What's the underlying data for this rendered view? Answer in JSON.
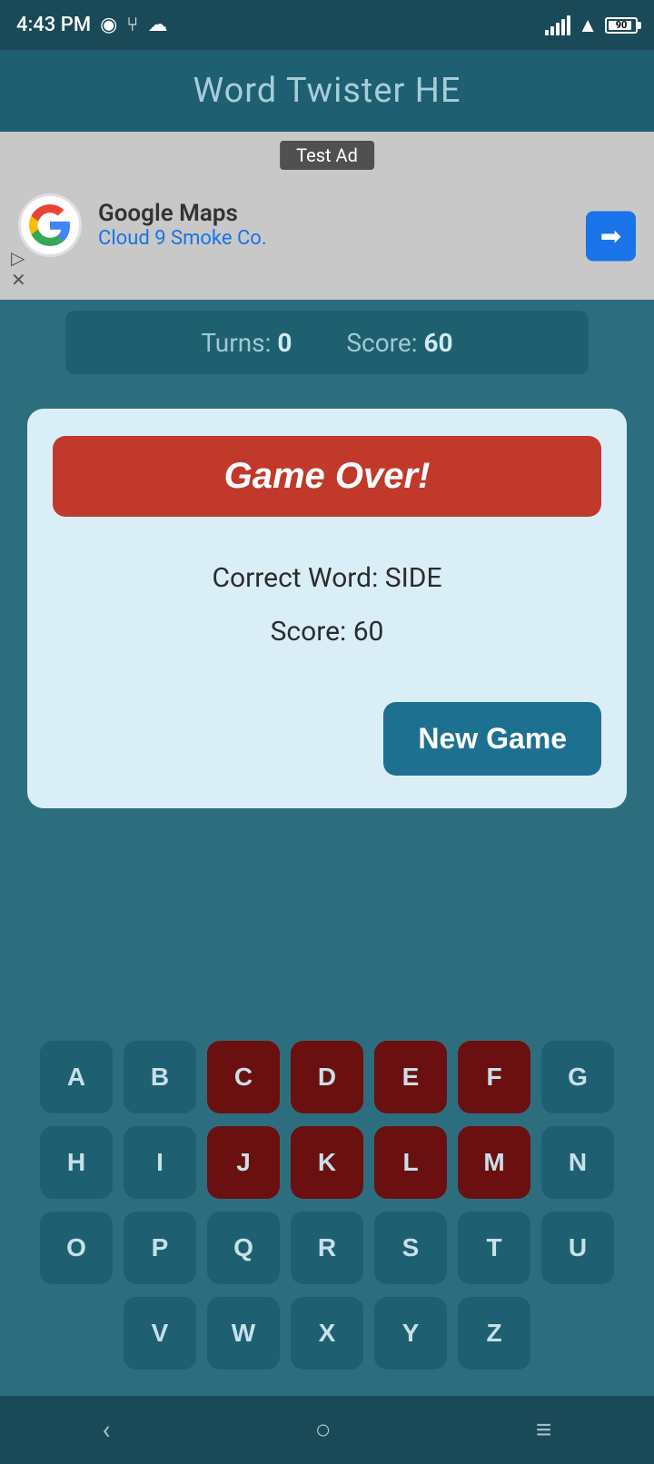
{
  "statusBar": {
    "time": "4:43 PM",
    "battery": "90"
  },
  "header": {
    "title": "Word Twister HE"
  },
  "ad": {
    "label": "Test Ad",
    "company": "Google Maps",
    "subtitle": "Cloud 9 Smoke Co."
  },
  "gameStats": {
    "turnsLabel": "Turns:",
    "turnsValue": "0",
    "scoreLabel": "Score:",
    "scoreValue": "60"
  },
  "dialog": {
    "gameOverLabel": "Game Over!",
    "correctWordLabel": "Correct Word: SIDE",
    "scoreLabel": "Score: 60",
    "newGameLabel": "New Game"
  },
  "keyboard": {
    "rows": [
      [
        "A",
        "B",
        "C",
        "D",
        "E",
        "F",
        "G"
      ],
      [
        "H",
        "I",
        "J",
        "K",
        "L",
        "M",
        "N"
      ],
      [
        "O",
        "P",
        "Q",
        "R",
        "S",
        "T",
        "U"
      ],
      [
        "V",
        "W",
        "X",
        "Y",
        "Z"
      ]
    ],
    "usedKeys": [
      "C",
      "D",
      "E",
      "F",
      "J",
      "K",
      "L",
      "M"
    ]
  },
  "navBar": {
    "back": "‹",
    "home": "○",
    "menu": "≡"
  }
}
